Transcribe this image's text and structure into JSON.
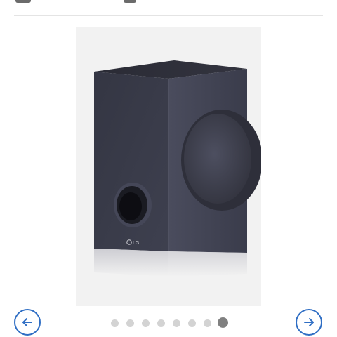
{
  "product": {
    "image_alt": "LG subwoofer",
    "brand_mark": "LG",
    "colors": {
      "cabinet": "#3b3d4c",
      "background": "#f2f2f2"
    }
  },
  "gallery": {
    "total_images": 8,
    "current_index": 8,
    "prev_icon": "arrow-left-icon",
    "next_icon": "arrow-right-icon",
    "accent_color": "#2f6ec4",
    "dot_color": "#d3d3d3",
    "active_dot_color": "#808080"
  }
}
